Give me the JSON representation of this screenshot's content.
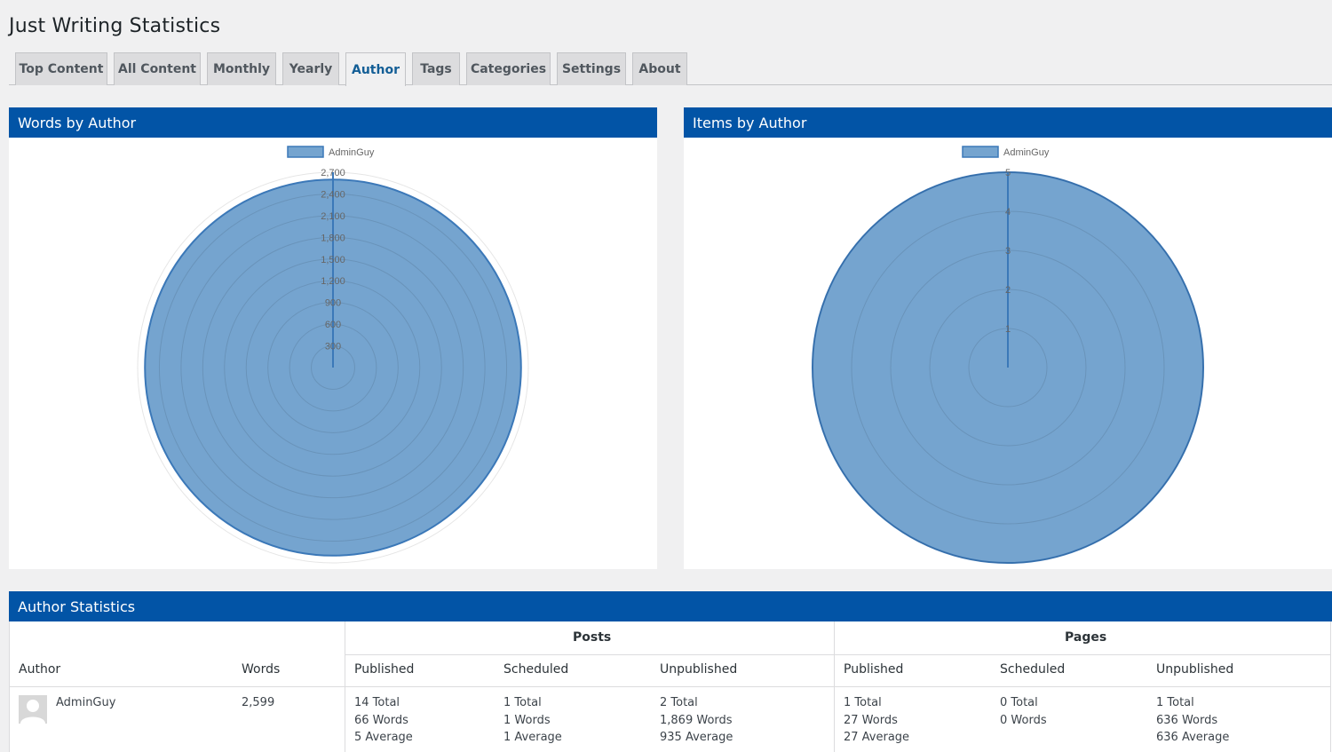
{
  "page": {
    "title": "Just Writing Statistics"
  },
  "tabs": [
    {
      "label": "Top Content"
    },
    {
      "label": "All Content"
    },
    {
      "label": "Monthly"
    },
    {
      "label": "Yearly"
    },
    {
      "label": "Author",
      "active": true
    },
    {
      "label": "Tags"
    },
    {
      "label": "Categories"
    },
    {
      "label": "Settings"
    },
    {
      "label": "About"
    }
  ],
  "colors": {
    "header_blue": "#0254a6",
    "area_fill": "#75a4cf",
    "area_stroke": "#3b78b8",
    "active_tab_text": "#135e96"
  },
  "words_panel": {
    "title": "Words by Author"
  },
  "items_panel": {
    "title": "Items by Author"
  },
  "chart_data": [
    {
      "type": "polarArea",
      "title": "Words by Author",
      "legend": [
        "AdminGuy"
      ],
      "legend_position": "top",
      "categories": [
        "AdminGuy"
      ],
      "values": [
        2599
      ],
      "rlim": [
        0,
        2700
      ],
      "ticks": [
        "300",
        "600",
        "900",
        "1,200",
        "1,500",
        "1,800",
        "2,100",
        "2,400",
        "2,700"
      ],
      "grid": true
    },
    {
      "type": "polarArea",
      "title": "Items by Author",
      "legend": [
        "AdminGuy"
      ],
      "legend_position": "top",
      "categories": [
        "AdminGuy"
      ],
      "values": [
        5
      ],
      "rlim": [
        0,
        5
      ],
      "ticks": [
        "1",
        "2",
        "3",
        "4",
        "5"
      ],
      "grid": true
    }
  ],
  "stats": {
    "title": "Author Statistics",
    "group_headers": {
      "posts": "Posts",
      "pages": "Pages"
    },
    "columns": {
      "author": "Author",
      "words": "Words",
      "posts_published": "Published",
      "posts_scheduled": "Scheduled",
      "posts_unpublished": "Unpublished",
      "pages_published": "Published",
      "pages_scheduled": "Scheduled",
      "pages_unpublished": "Unpublished"
    },
    "row": {
      "author": "AdminGuy",
      "words": "2,599",
      "posts_published": [
        "14 Total",
        "66 Words",
        "5 Average"
      ],
      "posts_scheduled": [
        "1 Total",
        "1 Words",
        "1 Average"
      ],
      "posts_unpublished": [
        "2 Total",
        "1,869 Words",
        "935 Average"
      ],
      "pages_published": [
        "1 Total",
        "27 Words",
        "27 Average"
      ],
      "pages_scheduled": [
        "0 Total",
        "0 Words"
      ],
      "pages_unpublished": [
        "1 Total",
        "636 Words",
        "636 Average"
      ]
    }
  }
}
